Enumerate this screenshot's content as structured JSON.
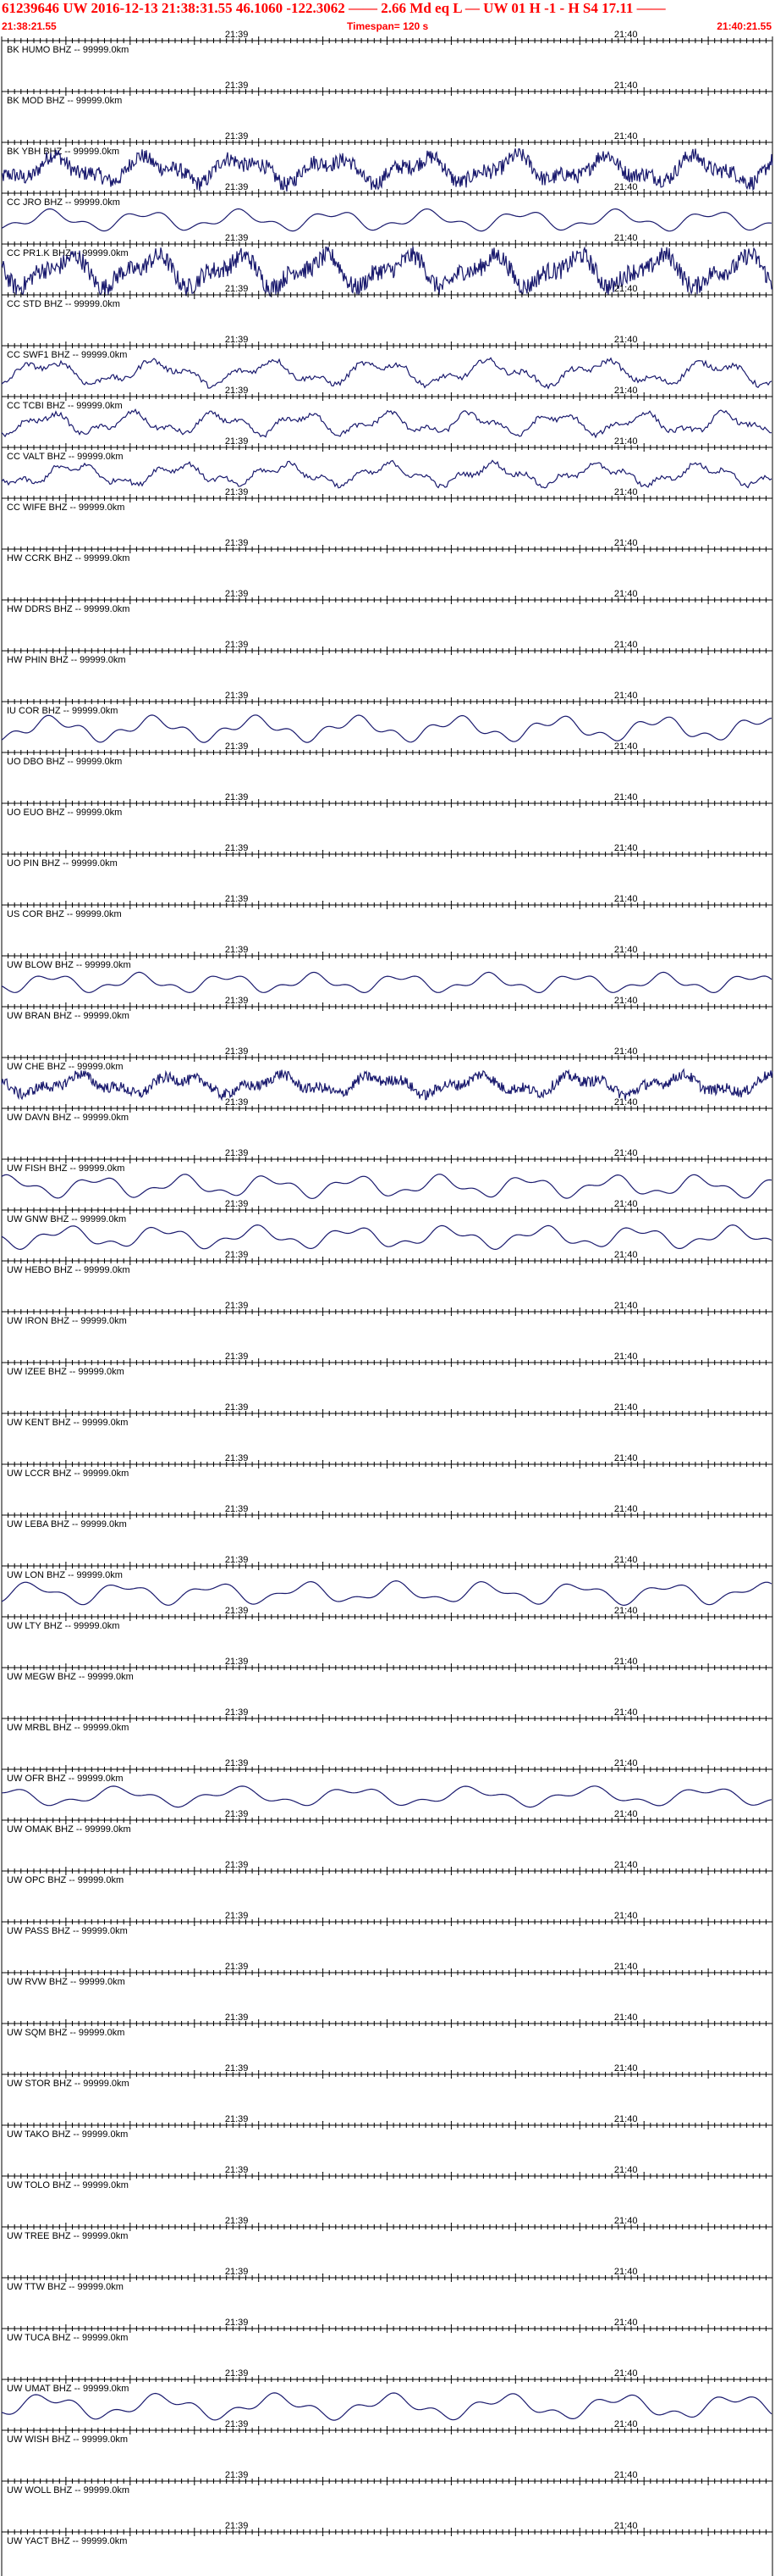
{
  "header": {
    "title": "61239646 UW 2016-12-13 21:38:31.55   46.1060 -122.3062 ——   2.66 Md  eq  L —     UW 01  H  -1  -  H S4   17.11 ——",
    "start_time": "21:38:21.55",
    "timespan": "Timespan= 120 s",
    "end_time": "21:40:21.55"
  },
  "chart_data": {
    "type": "line",
    "time_tick_labels": [
      "21:39",
      "21:40"
    ],
    "ticks_per_row": 121,
    "colors": {
      "trace": "#1a1a6e",
      "axis": "#000000",
      "header": "#ff0000"
    },
    "stations": [
      {
        "label": "BK HUMO BHZ -- 99999.0km",
        "kind": "flat"
      },
      {
        "label": "BK MOD BHZ -- 99999.0km",
        "kind": "flat"
      },
      {
        "label": "BK YBH BHZ -- 99999.0km",
        "kind": "noisy",
        "amp": 20
      },
      {
        "label": "CC JRO BHZ -- 99999.0km",
        "kind": "smooth",
        "amp": 15
      },
      {
        "label": "CC PR1.K BHZ -- 99999.0km",
        "kind": "noisy",
        "amp": 24
      },
      {
        "label": "CC STD BHZ -- 99999.0km",
        "kind": "flat"
      },
      {
        "label": "CC SWF1 BHZ -- 99999.0km",
        "kind": "mixed",
        "amp": 18
      },
      {
        "label": "CC TCBI BHZ -- 99999.0km",
        "kind": "mixed",
        "amp": 16
      },
      {
        "label": "CC VALT BHZ -- 99999.0km",
        "kind": "mixed",
        "amp": 16
      },
      {
        "label": "CC WIFE BHZ -- 99999.0km",
        "kind": "flat"
      },
      {
        "label": "HW CCRK BHZ -- 99999.0km",
        "kind": "flat"
      },
      {
        "label": "HW DDRS BHZ -- 99999.0km",
        "kind": "flat"
      },
      {
        "label": "HW PHIN BHZ -- 99999.0km",
        "kind": "flat"
      },
      {
        "label": "IU COR BHZ -- 99999.0km",
        "kind": "smooth",
        "amp": 18
      },
      {
        "label": "UO DBO BHZ -- 99999.0km",
        "kind": "flat"
      },
      {
        "label": "UO EUO BHZ -- 99999.0km",
        "kind": "flat"
      },
      {
        "label": "UO PIN BHZ -- 99999.0km",
        "kind": "flat"
      },
      {
        "label": "US COR BHZ -- 99999.0km",
        "kind": "flat"
      },
      {
        "label": "UW BLOW BHZ -- 99999.0km",
        "kind": "smooth",
        "amp": 14
      },
      {
        "label": "UW BRAN BHZ -- 99999.0km",
        "kind": "flat"
      },
      {
        "label": "UW CHE BHZ -- 99999.0km",
        "kind": "noisy",
        "amp": 14
      },
      {
        "label": "UW DAVN BHZ -- 99999.0km",
        "kind": "flat"
      },
      {
        "label": "UW FISH BHZ -- 99999.0km",
        "kind": "smooth",
        "amp": 16
      },
      {
        "label": "UW GNW BHZ -- 99999.0km",
        "kind": "smooth",
        "amp": 16
      },
      {
        "label": "UW HEBO BHZ -- 99999.0km",
        "kind": "flat"
      },
      {
        "label": "UW IRON BHZ -- 99999.0km",
        "kind": "flat"
      },
      {
        "label": "UW IZEE BHZ -- 99999.0km",
        "kind": "flat"
      },
      {
        "label": "UW KENT BHZ -- 99999.0km",
        "kind": "flat"
      },
      {
        "label": "UW LCCR BHZ -- 99999.0km",
        "kind": "flat"
      },
      {
        "label": "UW LEBA BHZ -- 99999.0km",
        "kind": "flat"
      },
      {
        "label": "UW LON BHZ -- 99999.0km",
        "kind": "smooth",
        "amp": 16
      },
      {
        "label": "UW LTY BHZ -- 99999.0km",
        "kind": "flat"
      },
      {
        "label": "UW MEGW BHZ -- 99999.0km",
        "kind": "flat"
      },
      {
        "label": "UW MRBL BHZ -- 99999.0km",
        "kind": "flat"
      },
      {
        "label": "UW OFR BHZ -- 99999.0km",
        "kind": "smooth",
        "amp": 14
      },
      {
        "label": "UW OMAK BHZ -- 99999.0km",
        "kind": "flat"
      },
      {
        "label": "UW OPC BHZ -- 99999.0km",
        "kind": "flat"
      },
      {
        "label": "UW PASS BHZ -- 99999.0km",
        "kind": "flat"
      },
      {
        "label": "UW RVW BHZ -- 99999.0km",
        "kind": "flat"
      },
      {
        "label": "UW SQM BHZ -- 99999.0km",
        "kind": "flat"
      },
      {
        "label": "UW STOR BHZ -- 99999.0km",
        "kind": "flat"
      },
      {
        "label": "UW TAKO BHZ -- 99999.0km",
        "kind": "flat"
      },
      {
        "label": "UW TOLO BHZ -- 99999.0km",
        "kind": "flat"
      },
      {
        "label": "UW TREE BHZ -- 99999.0km",
        "kind": "flat"
      },
      {
        "label": "UW TTW BHZ -- 99999.0km",
        "kind": "flat"
      },
      {
        "label": "UW TUCA BHZ -- 99999.0km",
        "kind": "flat"
      },
      {
        "label": "UW UMAT BHZ -- 99999.0km",
        "kind": "smooth",
        "amp": 18
      },
      {
        "label": "UW WISH BHZ -- 99999.0km",
        "kind": "flat"
      },
      {
        "label": "UW WOLL BHZ -- 99999.0km",
        "kind": "flat"
      },
      {
        "label": "UW YACT BHZ -- 99999.0km",
        "kind": "flat"
      }
    ]
  }
}
